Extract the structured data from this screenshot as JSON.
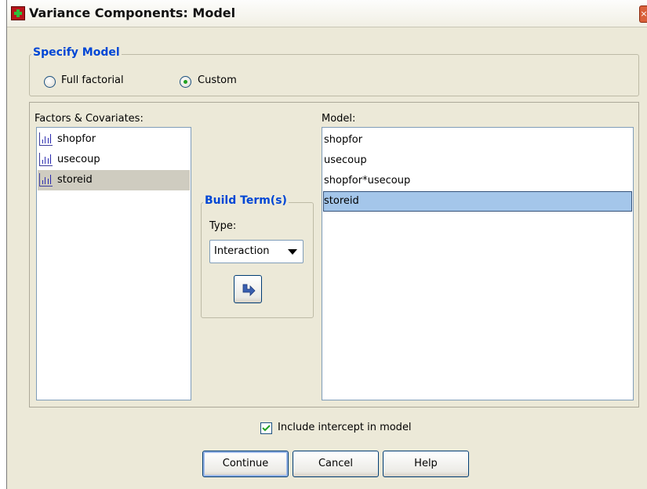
{
  "window": {
    "title": "Variance Components: Model",
    "close_glyph": "×"
  },
  "specify_model": {
    "title": "Specify Model",
    "options": [
      {
        "label": "Full factorial",
        "checked": false
      },
      {
        "label": "Custom",
        "checked": true
      }
    ]
  },
  "factors": {
    "label": "Factors & Covariates:",
    "items": [
      {
        "label": "shopfor",
        "icon": "nominal-variable-icon",
        "selected": false
      },
      {
        "label": "usecoup",
        "icon": "nominal-variable-icon",
        "selected": false
      },
      {
        "label": "storeid",
        "icon": "nominal-variable-icon",
        "selected": true
      }
    ]
  },
  "build_terms": {
    "title": "Build Term(s)",
    "type_label": "Type:",
    "type_value": "Interaction",
    "move_icon": "arrow-right-icon"
  },
  "model": {
    "label": "Model:",
    "items": [
      {
        "label": "shopfor",
        "selected": false
      },
      {
        "label": "usecoup",
        "selected": false
      },
      {
        "label": "shopfor*usecoup",
        "selected": false
      },
      {
        "label": "storeid",
        "selected": true
      }
    ]
  },
  "intercept": {
    "label": "Include intercept in model",
    "checked": true
  },
  "buttons": {
    "continue": "Continue",
    "cancel": "Cancel",
    "help": "Help"
  },
  "colors": {
    "group_title": "#0046d5",
    "dialog_bg": "#ece9d8",
    "selection_blue": "#a4c6ea"
  }
}
